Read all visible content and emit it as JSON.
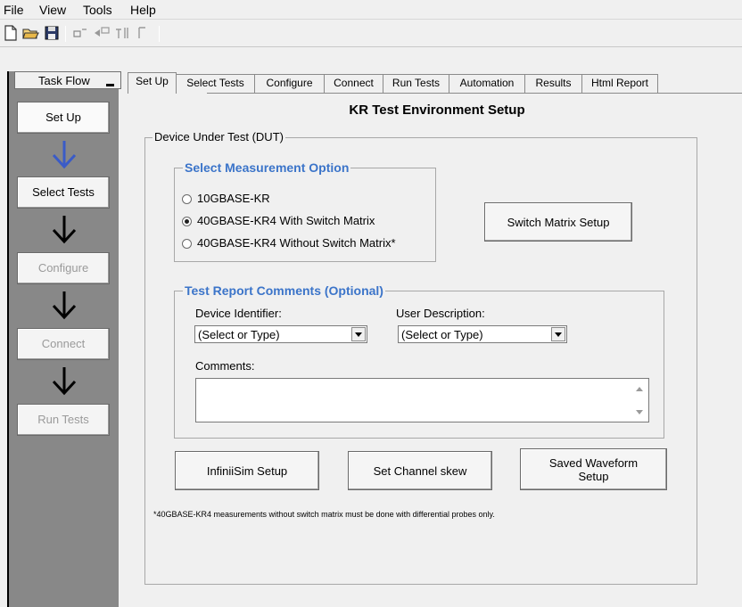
{
  "menu": [
    "File",
    "View",
    "Tools",
    "Help"
  ],
  "toolbar_icons": [
    "new-file-icon",
    "open-folder-icon",
    "save-icon",
    "run-icon",
    "stop-icon",
    "step-icon",
    "pause-icon"
  ],
  "taskflow": {
    "title": "Task Flow",
    "steps": [
      {
        "label": "Set Up",
        "state": "active"
      },
      {
        "label": "Select Tests",
        "state": "enabled"
      },
      {
        "label": "Configure",
        "state": "disabled"
      },
      {
        "label": "Connect",
        "state": "disabled"
      },
      {
        "label": "Run Tests",
        "state": "disabled"
      }
    ]
  },
  "tabs": [
    "Set Up",
    "Select Tests",
    "Configure",
    "Connect",
    "Run Tests",
    "Automation",
    "Results",
    "Html Report"
  ],
  "page_title": "KR Test Environment Setup",
  "dut_group_title": "Device Under Test (DUT)",
  "measurement": {
    "title": "Select Measurement Option",
    "options": [
      "10GBASE-KR",
      "40GBASE-KR4 With Switch Matrix",
      "40GBASE-KR4 Without Switch Matrix*"
    ],
    "selected": "40GBASE-KR4 With Switch Matrix"
  },
  "switch_matrix_button": "Switch Matrix Setup",
  "comments_group": {
    "title": "Test Report Comments (Optional)",
    "device_identifier_label": "Device Identifier:",
    "device_identifier_value": "(Select or Type)",
    "user_description_label": "User Description:",
    "user_description_value": "(Select or Type)",
    "comments_label": "Comments:",
    "comments_value": ""
  },
  "buttons": {
    "infiniisim": "InfiniiSim Setup",
    "channel_skew": "Set Channel skew",
    "saved_waveform_line1": "Saved Waveform",
    "saved_waveform_line2": "Setup"
  },
  "footnote": "*40GBASE-KR4 measurements without switch matrix must be done with differential probes only.",
  "colors": {
    "accent_blue": "#3b74c9",
    "arrow_blue": "#3a5bc7",
    "panel_gray": "#888888"
  }
}
